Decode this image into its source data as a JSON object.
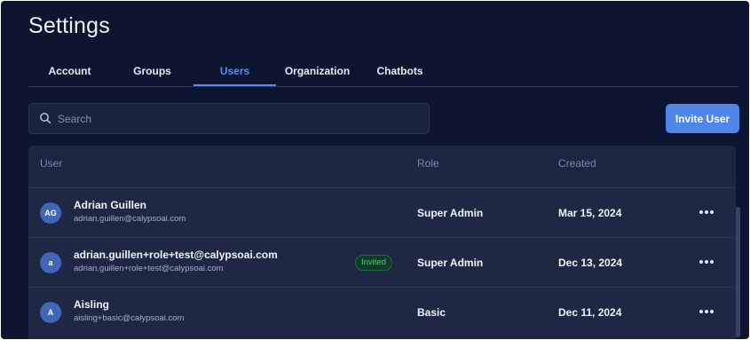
{
  "page": {
    "title": "Settings"
  },
  "tabs": [
    {
      "label": "Account",
      "active": false
    },
    {
      "label": "Groups",
      "active": false
    },
    {
      "label": "Users",
      "active": true
    },
    {
      "label": "Organization",
      "active": false
    },
    {
      "label": "Chatbots",
      "active": false
    }
  ],
  "search": {
    "placeholder": "Search",
    "icon": "search-icon"
  },
  "invite_button": {
    "label": "Invite User"
  },
  "table": {
    "headers": {
      "user": "User",
      "role": "Role",
      "created": "Created"
    },
    "rows": [
      {
        "initials": "AG",
        "name": "Adrian Guillen",
        "email": "adrian.guillen@calypsoai.com",
        "badge": "",
        "role": "Super Admin",
        "created": "Mar 15, 2024"
      },
      {
        "initials": "a",
        "name": "adrian.guillen+role+test@calypsoai.com",
        "email": "adrian.guillen+role+test@calypsoai.com",
        "badge": "Invited",
        "role": "Super Admin",
        "created": "Dec 13, 2024"
      },
      {
        "initials": "A",
        "name": "Aisling",
        "email": "aisling+basic@calypsoai.com",
        "badge": "",
        "role": "Basic",
        "created": "Dec 11, 2024"
      }
    ]
  },
  "colors": {
    "background": "#0d1530",
    "accent": "#4f86ea",
    "active_tab": "#5b8df1",
    "invited_badge": "#3fd081",
    "avatar": "#3f66b8"
  }
}
